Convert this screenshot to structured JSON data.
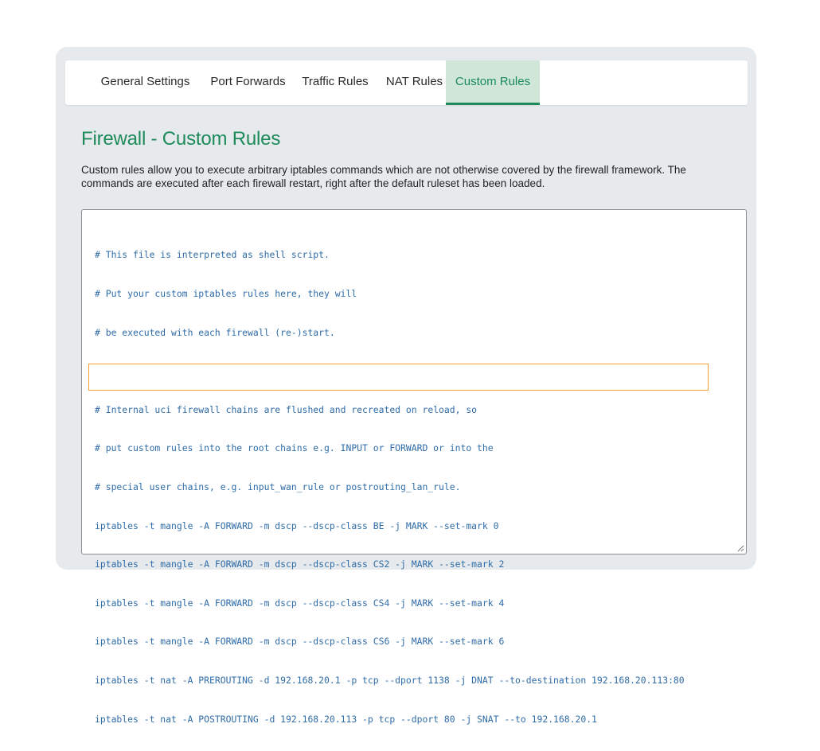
{
  "tabs": [
    {
      "label": "General Settings",
      "active": false
    },
    {
      "label": "Port Forwards",
      "active": false
    },
    {
      "label": "Traffic Rules",
      "active": false
    },
    {
      "label": "NAT Rules",
      "active": false
    },
    {
      "label": "Custom Rules",
      "active": true
    }
  ],
  "page": {
    "title": "Firewall - Custom Rules",
    "description": "Custom rules allow you to execute arbitrary iptables commands which are not otherwise covered by the firewall framework. The commands are executed after each firewall restart, right after the default ruleset has been loaded."
  },
  "editor": {
    "lines": [
      "# This file is interpreted as shell script.",
      "# Put your custom iptables rules here, they will",
      "# be executed with each firewall (re-)start.",
      "",
      "# Internal uci firewall chains are flushed and recreated on reload, so",
      "# put custom rules into the root chains e.g. INPUT or FORWARD or into the",
      "# special user chains, e.g. input_wan_rule or postrouting_lan_rule.",
      "iptables -t mangle -A FORWARD -m dscp --dscp-class BE -j MARK --set-mark 0",
      "iptables -t mangle -A FORWARD -m dscp --dscp-class CS2 -j MARK --set-mark 2",
      "iptables -t mangle -A FORWARD -m dscp --dscp-class CS4 -j MARK --set-mark 4",
      "iptables -t mangle -A FORWARD -m dscp --dscp-class CS6 -j MARK --set-mark 6",
      "iptables -t nat -A PREROUTING -d 192.168.20.1 -p tcp --dport 1138 -j DNAT --to-destination 192.168.20.113:80",
      "iptables -t nat -A POSTROUTING -d 192.168.20.113 -p tcp --dport 80 -j SNAT --to 192.168.20.1"
    ]
  },
  "colors": {
    "accent": "#1d8a5a",
    "active_tab_bg": "#cfe6d9",
    "code_text": "#2f6ca8",
    "highlight_border": "#f0a030",
    "panel_bg": "#e7eaed"
  }
}
